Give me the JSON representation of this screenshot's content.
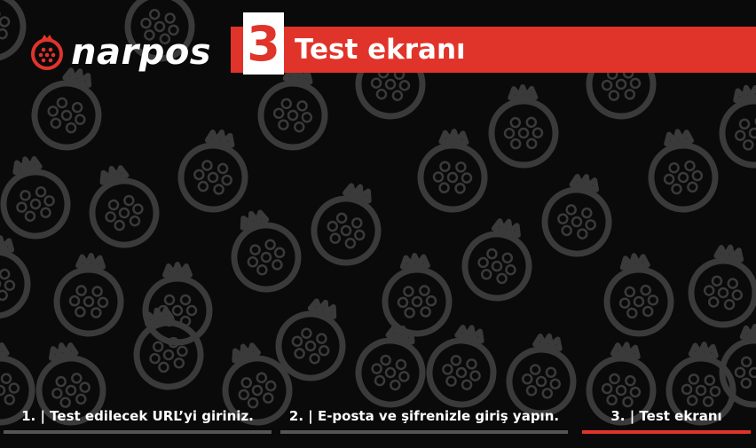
{
  "brand": {
    "logo_text": "narpos",
    "accent": "#e0342a"
  },
  "header": {
    "step_number": "3",
    "step_title": "Test ekranı"
  },
  "steps": [
    {
      "label": "1. | Test edilecek URL’yi giriniz.",
      "active": false
    },
    {
      "label": "2. | E-posta ve şifrenizle giriş yapın.",
      "active": false
    },
    {
      "label": "3. | Test ekranı",
      "active": true
    }
  ],
  "colors": {
    "background": "#0a0a0a",
    "pattern": "#3a3a3a",
    "inactive_bar": "#555555",
    "active_bar": "#e0342a"
  },
  "background_icon": "pomegranate-icon"
}
